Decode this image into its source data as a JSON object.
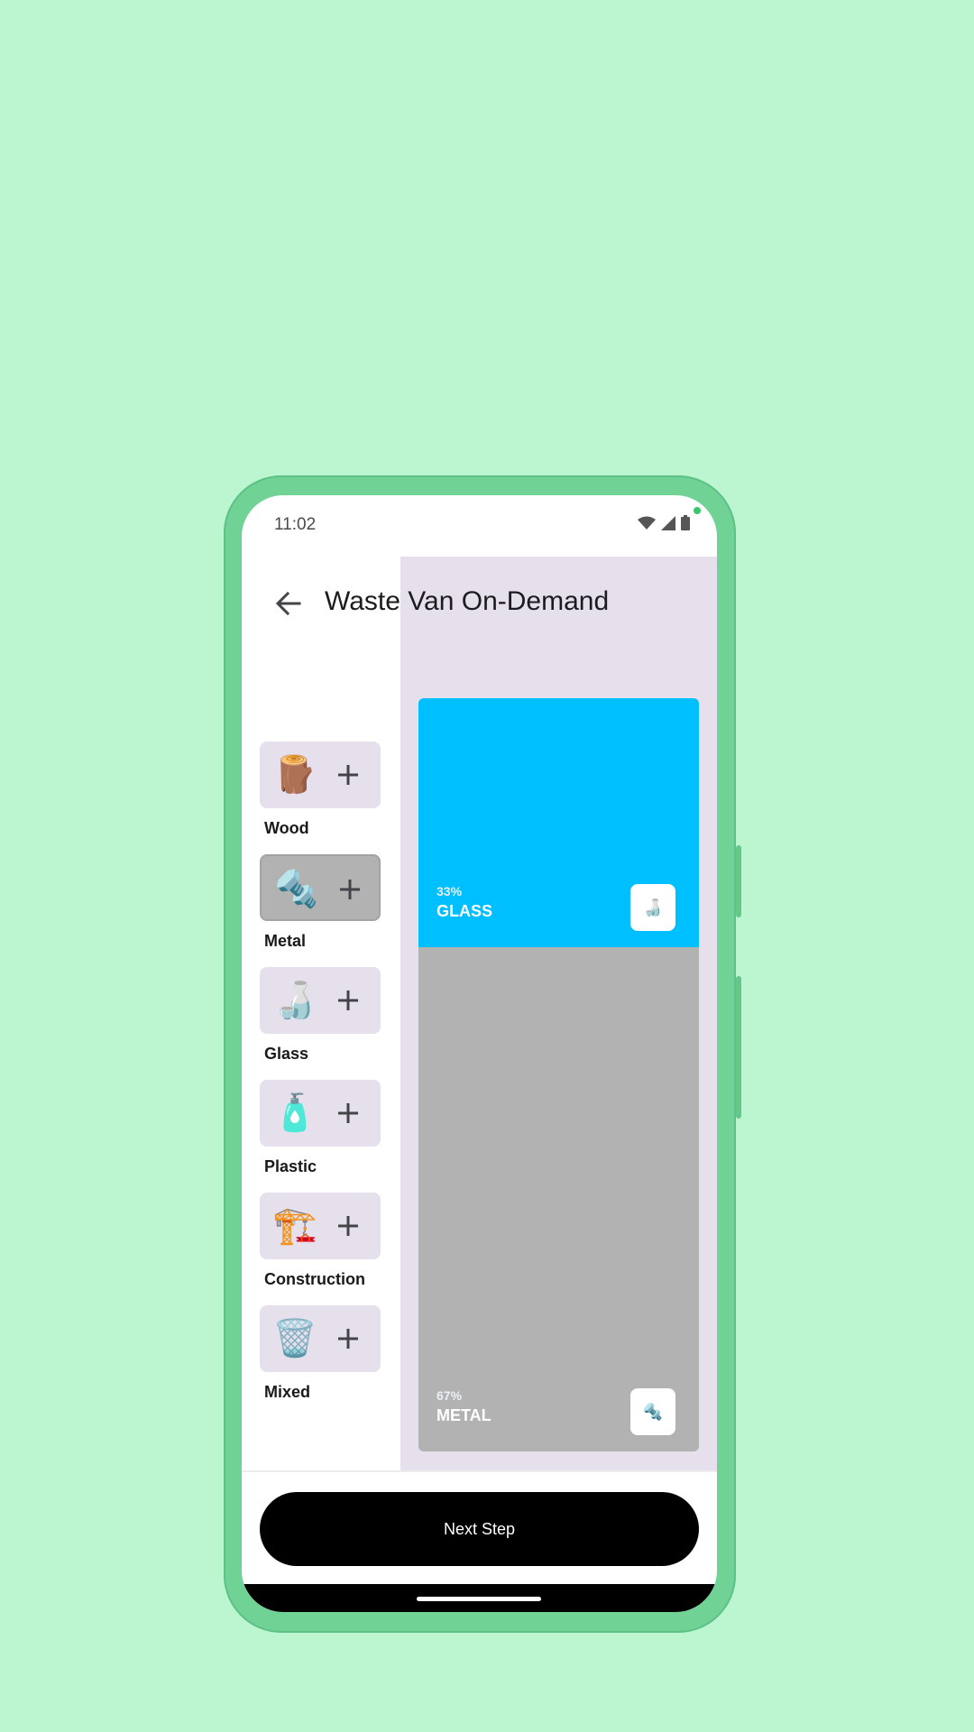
{
  "status_bar": {
    "time": "11:02"
  },
  "app_bar": {
    "title": "Waste Van On-Demand"
  },
  "categories": [
    {
      "label": "Wood",
      "emoji": "🪵",
      "icon": "wood-log-icon",
      "selected": false
    },
    {
      "label": "Metal",
      "emoji": "🔩",
      "icon": "metal-bolt-icon",
      "selected": true
    },
    {
      "label": "Glass",
      "emoji": "🍶",
      "icon": "glass-bottle-icon",
      "selected": false
    },
    {
      "label": "Plastic",
      "emoji": "🧴",
      "icon": "plastic-bottle-icon",
      "selected": false
    },
    {
      "label": "Construction",
      "emoji": "🏗️",
      "icon": "construction-crane-icon",
      "selected": false
    },
    {
      "label": "Mixed",
      "emoji": "🗑️",
      "icon": "trash-bin-icon",
      "selected": false
    }
  ],
  "chart_data": {
    "type": "stacked-bar",
    "segments": [
      {
        "name": "GLASS",
        "percent_label": "33%",
        "value": 33,
        "color": "#00bfff",
        "emoji": "🍶",
        "icon": "glass-bottle-icon"
      },
      {
        "name": "METAL",
        "percent_label": "67%",
        "value": 67,
        "color": "#b2b2b2",
        "emoji": "🔩",
        "icon": "metal-bolt-icon"
      }
    ]
  },
  "footer": {
    "next_label": "Next Step"
  },
  "colors": {
    "background": "#bbf6d1",
    "phone_frame": "#70d395",
    "panel": "#e6e0ec",
    "glass": "#00bfff",
    "metal": "#b2b2b2",
    "button": "#000000"
  }
}
